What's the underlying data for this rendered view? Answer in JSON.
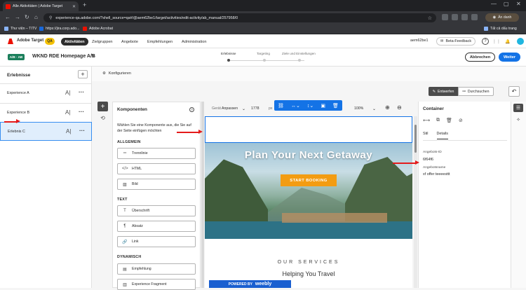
{
  "browser": {
    "tab_title": "Alle Aktivitäten | Adobe Target",
    "url": "experience-qa.adobe.com/?shell_source=qa#/@aem62be1/target/activities/edit-activity/ab_manual/257958/0",
    "profile_label": "Ẩn danh",
    "bookmarks": [
      "Thư viện – TITV",
      "https://jira.corp.ado...",
      "Adobe Acrobat"
    ],
    "bookmarks_right": "Tất cả dấu trang"
  },
  "app": {
    "product_name": "Adobe Target",
    "env_badge": "QA",
    "nav": [
      "Aktivitäten",
      "Zielgruppen",
      "Angebote",
      "Empfehlungen",
      "Administration"
    ],
    "org": "aem62be1",
    "beta_feedback": "Beta-Feedback",
    "notif_count": "3"
  },
  "activity": {
    "badge": "A/B · AB",
    "title": "WKND RDE Homepage A/B",
    "steps": [
      "Erlebnisse",
      "Targeting",
      "Ziele und Einstellungen"
    ],
    "cancel": "Abbrechen",
    "next": "Weiter"
  },
  "experiences": {
    "heading": "Erlebnisse",
    "items": [
      "Experience A",
      "Experience B",
      "Erlebnis C"
    ],
    "selected_index": 2
  },
  "toolbar": {
    "configure": "Konfigurieren",
    "modes": [
      "Entwerfen",
      "Durchsuchen"
    ]
  },
  "components": {
    "heading": "Komponenten",
    "description": "Wählen Sie eine Komponente aus, die Sie auf der Seite einfügen möchten",
    "sections": [
      {
        "title": "ALLGEMEIN",
        "items": [
          "Trennlinie",
          "HTML",
          "Bild"
        ]
      },
      {
        "title": "TEXT",
        "items": [
          "Überschrift",
          "Absatz",
          "Link"
        ]
      },
      {
        "title": "DYNAMISCH",
        "items": [
          "Empfehlung",
          "Experience Fragment"
        ]
      }
    ]
  },
  "canvas": {
    "device_label": "Gerät",
    "device_value": "Anpassen",
    "width": "1778",
    "unit": "px",
    "zoom": "100%",
    "hero_headline": "Plan Your Next Getaway",
    "hero_cta": "START BOOKING",
    "services": "OUR SERVICES",
    "helping": "Helping You Travel",
    "powered": "POWERED BY",
    "weebly": "weebly"
  },
  "properties": {
    "heading": "Container",
    "tabs": [
      "Stil",
      "Details"
    ],
    "offer_id_label": "Angebots-ID",
    "offer_id_value": "6f64f6",
    "offer_name_label": "Angebotsname",
    "offer_name_value": "xf offer teeeesttt"
  },
  "colors": {
    "accent_blue": "#1473e6",
    "adobe_red": "#eb1000",
    "qa_yellow": "#f3c000",
    "annotation_red": "#e41b1b"
  }
}
